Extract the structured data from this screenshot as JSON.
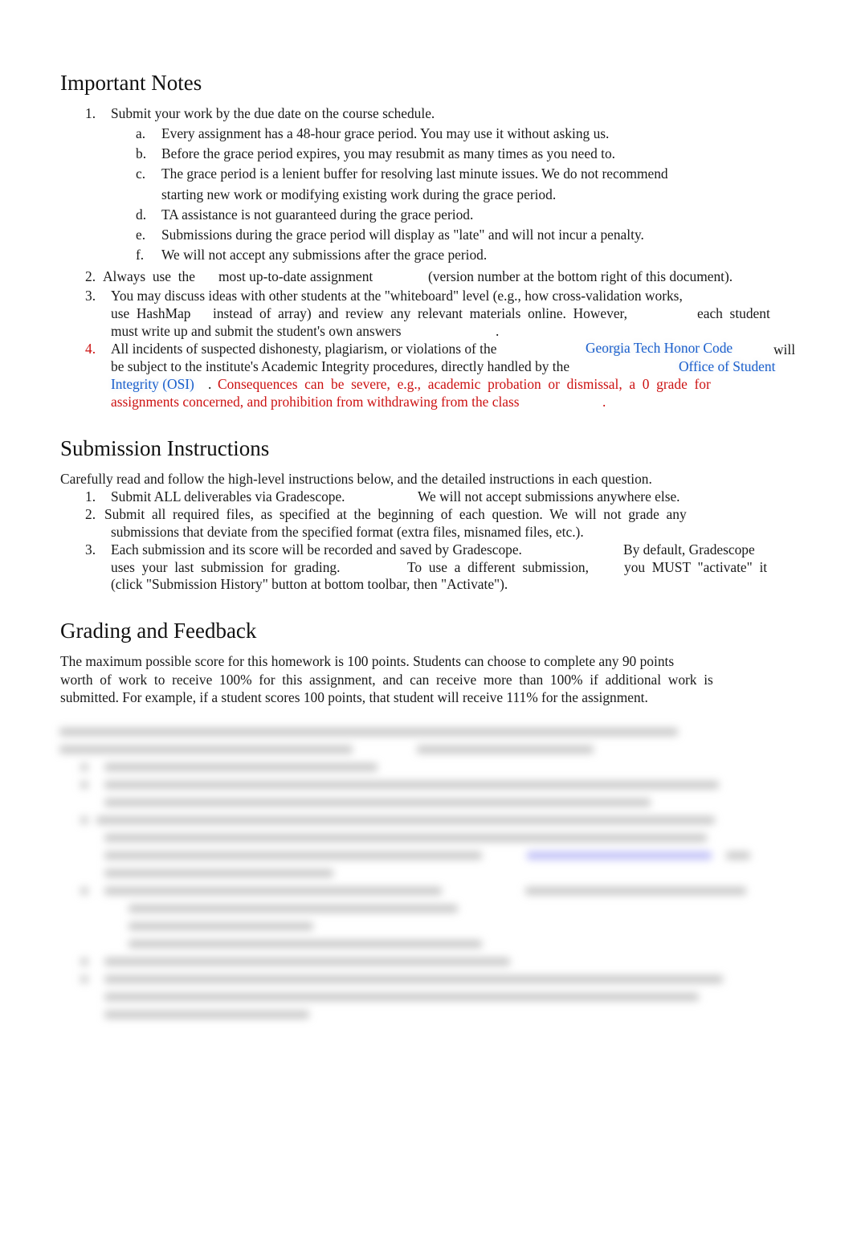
{
  "important_notes": {
    "heading": "Important Notes",
    "items": [
      {
        "num": "1.",
        "text": "Submit your work by the due date on the course schedule.",
        "subitems": [
          {
            "letter": "a.",
            "text": "Every assignment has a 48-hour grace period. You may use it without asking us."
          },
          {
            "letter": "b.",
            "text": "Before the grace period expires, you may resubmit as many times as you need to."
          },
          {
            "letter": "c.",
            "text": "The grace period is a lenient buffer for resolving last minute issues. We do not recommend",
            "text2": "starting new work or modifying existing work during the grace period."
          },
          {
            "letter": "d.",
            "text": "TA assistance is not guaranteed during the grace period."
          },
          {
            "letter": "e.",
            "text": "Submissions during the grace period will display as \"late\" and will not incur a penalty."
          },
          {
            "letter": "f.",
            "text": "We will not accept any submissions after the grace period."
          }
        ]
      },
      {
        "num": "2.",
        "part1": "Always  use  the",
        "part2": "most up-to-date assignment",
        "part3": "(version number at the bottom right of this document)."
      },
      {
        "num": "3.",
        "line1": "You may discuss ideas with other students at the \"whiteboard\" level (e.g., how cross-validation works,",
        "line2a": "use  HashMap",
        "line2b": "instead  of  array)  and  review  any  relevant  materials  online.  However,",
        "line2c": "each  student",
        "line3a": "must write up and submit the student's own answers",
        "line3b": "."
      },
      {
        "num": "4.",
        "line1a": "All incidents of suspected dishonesty, plagiarism, or violations of the",
        "link1": "Georgia Tech Honor Code",
        "line1b": "will",
        "line2a": "be subject to the institute's Academic Integrity procedures, directly handled by the",
        "link2a": "Office of Student",
        "link2b": "Integrity (OSI)",
        "line3a": ".",
        "warn1": "Consequences  can  be  severe,  e.g.,  academic  probation  or  dismissal,  a  0  grade  for",
        "warn2": "assignments concerned, and prohibition from withdrawing from the class",
        "warn_end": "."
      }
    ]
  },
  "submission_instructions": {
    "heading": "Submission Instructions",
    "intro": "Carefully read and follow the high-level instructions below, and the detailed instructions in each question.",
    "items": [
      {
        "num": "1.",
        "a": "Submit ALL deliverables via Gradescope.",
        "b": "We will not accept submissions anywhere else."
      },
      {
        "num": "2.",
        "a": "Submit  all  required  files,  as  specified  at  the  beginning  of  each  question.  We  will  not  grade  any",
        "b": "submissions that deviate from the specified format (extra files, misnamed files, etc.)."
      },
      {
        "num": "3.",
        "a": "Each submission and its score will be recorded and saved by Gradescope.",
        "b": "By default, Gradescope",
        "c": "uses  your  last  submission  for  grading.",
        "d": "To  use  a  different  submission,",
        "e": "you  MUST  \"activate\"  it",
        "f": "(click \"Submission History\" button at bottom toolbar, then \"Activate\")."
      }
    ]
  },
  "grading": {
    "heading": "Grading and Feedback",
    "line1": "The maximum possible score for this homework is 100 points. Students can choose to complete any 90 points",
    "line2": "worth  of  work  to  receive  100%  for  this  assignment,  and  can  receive  more  than  100%  if  additional  work  is",
    "line3": "submitted. For example, if a student scores 100 points, that student will receive 111% for the assignment."
  }
}
